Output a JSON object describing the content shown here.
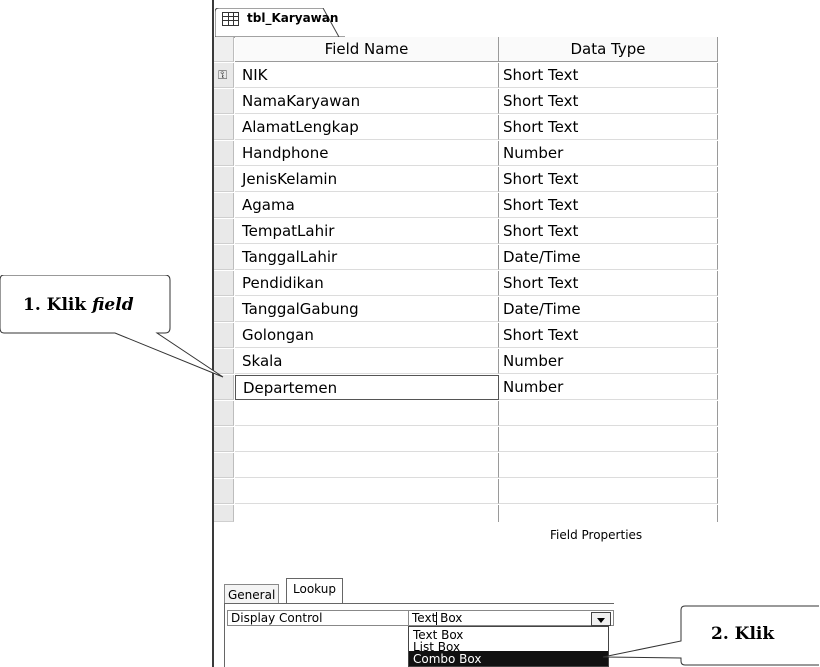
{
  "tab": {
    "label": "tbl_Karyawan"
  },
  "grid": {
    "headers": {
      "field_name": "Field Name",
      "data_type": "Data Type"
    },
    "rows": [
      {
        "field": "NIK",
        "type": "Short Text"
      },
      {
        "field": "NamaKaryawan",
        "type": "Short Text"
      },
      {
        "field": "AlamatLengkap",
        "type": "Short Text"
      },
      {
        "field": "Handphone",
        "type": "Number"
      },
      {
        "field": "JenisKelamin",
        "type": "Short Text"
      },
      {
        "field": "Agama",
        "type": "Short Text"
      },
      {
        "field": "TempatLahir",
        "type": "Short Text"
      },
      {
        "field": "TanggalLahir",
        "type": "Date/Time"
      },
      {
        "field": "Pendidikan",
        "type": "Short Text"
      },
      {
        "field": "TanggalGabung",
        "type": "Date/Time"
      },
      {
        "field": "Golongan",
        "type": "Short Text"
      },
      {
        "field": "Skala",
        "type": "Number"
      },
      {
        "field": "Departemen",
        "type": "Number"
      }
    ]
  },
  "field_properties": {
    "title": "Field Properties",
    "tabs": {
      "general": "General",
      "lookup": "Lookup"
    },
    "display_control": {
      "label": "Display Control",
      "value": "Text Box",
      "options": [
        "Text Box",
        "List Box",
        "Combo Box"
      ],
      "selected_option": "Combo Box"
    }
  },
  "callouts": {
    "step1_prefix": "1. Klik ",
    "step1_emph": "field",
    "step2": "2. Klik"
  },
  "icons": {
    "tab": "table-icon",
    "primary_key": "key-icon",
    "dropdown": "chevron-down-icon"
  }
}
